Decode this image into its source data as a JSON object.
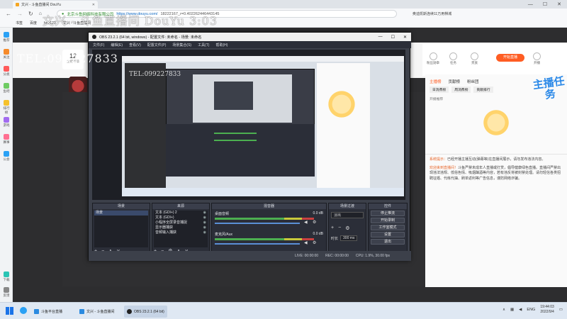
{
  "browser": {
    "tab_title": "文兴 - 斗鱼直播间 DouYu",
    "url_domain": "https://www.douyu.com/",
    "url_path": "18222167_r=0.402262446443145",
    "url_prefix": "北京斗鱼网络科技有限公司",
    "right_news": "奥迪凯斯连续11万用棋城",
    "bookmarks": [
      "书签",
      "百度",
      "hao123",
      "文兴 - 斗鱼直播间"
    ],
    "window_controls": [
      "—",
      "☐",
      "✕"
    ]
  },
  "watermark": {
    "top": "文兴 - 斗鱼直播间 DouYu 3:03",
    "left": "TEL:099227833",
    "inner": "TEL:099227833"
  },
  "sidebar": [
    {
      "label": "推荐",
      "color": "#2aa1f5"
    },
    {
      "label": "关注",
      "color": "#f58a2a"
    },
    {
      "label": "分类",
      "color": "#ff5a5a"
    },
    {
      "label": "鱼吧",
      "color": "#6ecb63"
    },
    {
      "label": "排行榜",
      "color": "#f5c12a"
    },
    {
      "label": "游戏",
      "color": "#a26cf0"
    },
    {
      "label": "赛事",
      "color": "#ff6f91"
    },
    {
      "label": "公会",
      "color": "#2aa1f5"
    },
    {
      "label": "下载",
      "color": "#2ac4b4"
    },
    {
      "label": "反馈",
      "color": "#888888"
    }
  ],
  "room": {
    "card_number": "12",
    "card_label": "主播等级"
  },
  "right_panel": {
    "icons": [
      "粉丝勋章",
      "任务",
      "贵族",
      "开播"
    ],
    "open_button": "开始直播",
    "tabs": [
      "主播榜",
      "贡献榜",
      "粉丝团"
    ],
    "sub_tabs": [
      "日消费榜",
      "周消费榜",
      "贡献排行"
    ],
    "rank_placeholder": "开播推荐",
    "promo": "主播任务",
    "system_msg_prefix": "系统提示：",
    "system_msg": "已经开播主播互动(弹幕等)在直播间展示，请勿发布违法内容。",
    "rules_prefix": "欢迎来到直播间！",
    "rules": "斗鱼严禁未成年人直播或打赏，倡导健康绿色直播。直播间严禁出现违法违规、低俗色情、吸烟酗酒等内容，若有违反将被封禁处理。请勿轻信各类招聘征婚、代练代抽、刷单返利等广告信息，谨防网络诈骗。"
  },
  "obs": {
    "title": "OBS 23.2.1 (64 bit, windows) - 配置文件: 未命名 - 场景: 未命名",
    "menu": [
      "文件(F)",
      "编辑(E)",
      "查看(V)",
      "配置文件(P)",
      "场景集合(S)",
      "工具(T)",
      "帮助(H)"
    ],
    "docks": {
      "scenes": {
        "title": "场景",
        "items": [
          "场景"
        ]
      },
      "sources": {
        "title": "来源",
        "items": [
          "文本 (GDI+) 2",
          "文本 (GDI+)",
          "小程序全屏录音捕捉",
          "显示器捕获",
          "音频输入捕获"
        ]
      },
      "mixer": {
        "title": "混音器",
        "channels": [
          {
            "name": "桌面音频",
            "level": "0.0 dB"
          },
          {
            "name": "麦克风/Aux",
            "level": "0.0 dB"
          }
        ]
      },
      "transitions": {
        "title": "场景过渡",
        "type": "淡出",
        "duration_label": "时长",
        "duration": "300 ms"
      },
      "controls": {
        "title": "控件",
        "buttons": [
          "停止推流",
          "开始录制",
          "工作室模式",
          "设置",
          "退出"
        ]
      }
    },
    "status": {
      "live": "LIVE: 00:00:00",
      "rec": "REC: 00:00:00",
      "cpu": "CPU: 1.9%, 30.00 fps"
    }
  },
  "taskbar": {
    "items": [
      {
        "label": "斗鱼平台直播",
        "active": false
      },
      {
        "label": "文兴 - 斗鱼直播间",
        "active": false
      },
      {
        "label": "OBS 23.2.1 (64 bit)",
        "active": true
      }
    ],
    "lang": "ENG",
    "time": "19:44:03",
    "date": "2022/9/4"
  }
}
